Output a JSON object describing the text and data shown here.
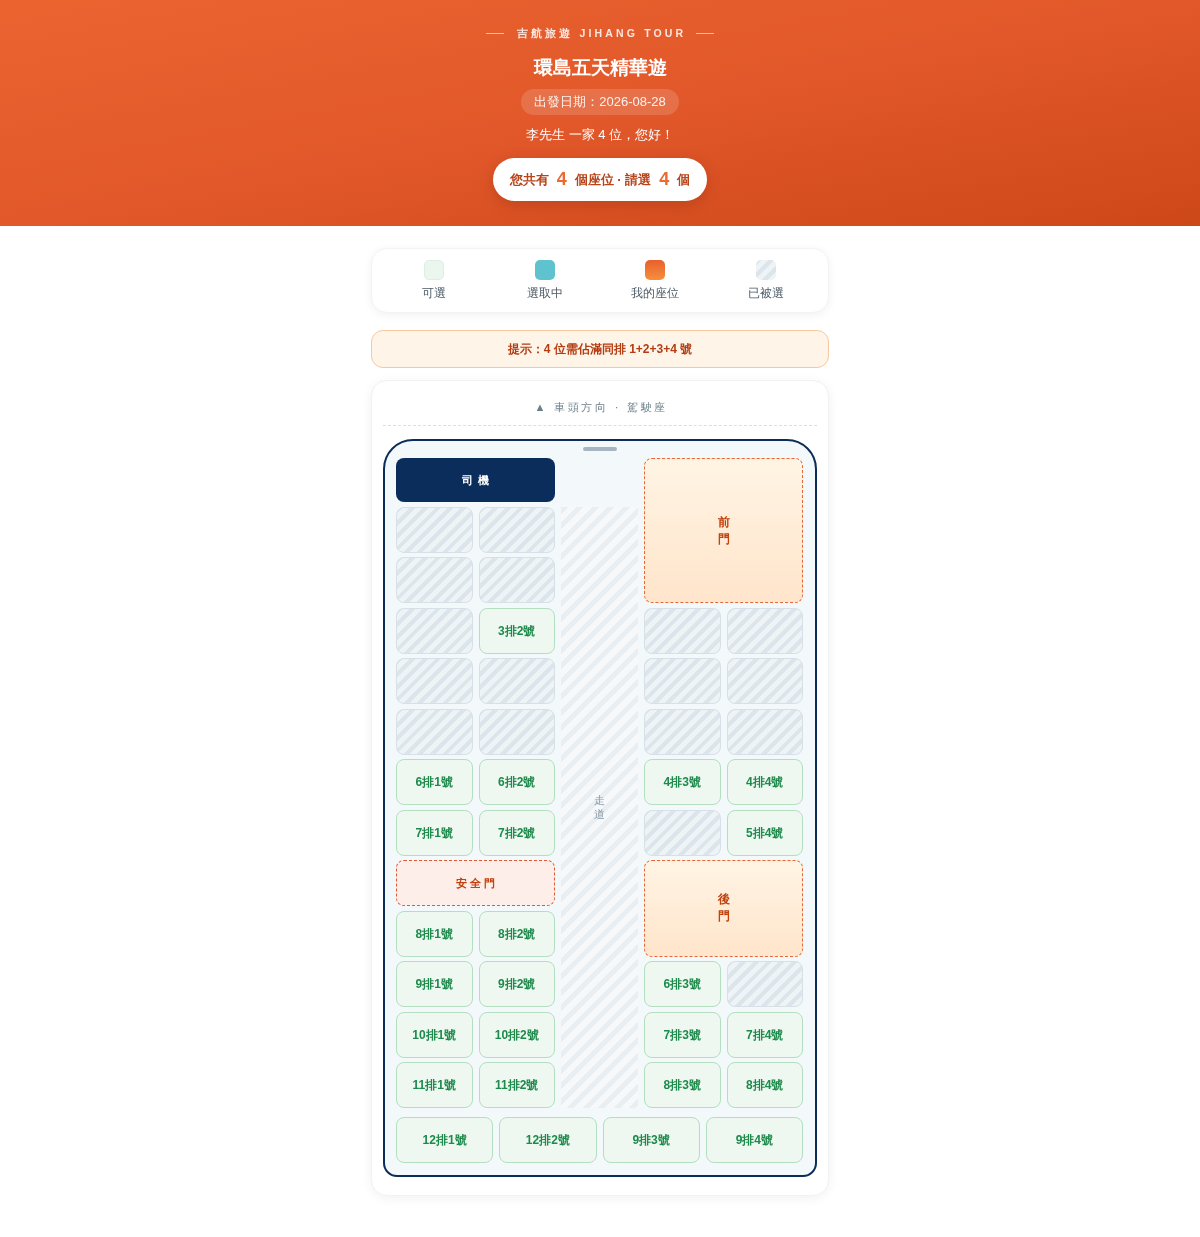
{
  "header": {
    "brand": "吉航旅遊 JIHANG TOUR",
    "title": "環島五天精華遊",
    "date": "出發日期：2026-08-28",
    "greeting": "李先生 一家 4 位，您好！",
    "summary": [
      {
        "kind": "text",
        "text": "您共有"
      },
      {
        "kind": "count",
        "text": "4"
      },
      {
        "kind": "text",
        "text": "個座位 · 請選"
      },
      {
        "kind": "count",
        "text": "4"
      },
      {
        "kind": "text",
        "text": "個"
      }
    ]
  },
  "legend": [
    {
      "kind": "available",
      "label": "可選"
    },
    {
      "kind": "selected",
      "label": "選取中"
    },
    {
      "kind": "mine",
      "label": "我的座位"
    },
    {
      "kind": "taken",
      "label": "已被選"
    }
  ],
  "hint": "提示：4 位需佔滿同排 1+2+3+4 號",
  "seat_map": {
    "direction": "▲ 車頭方向 · 駕駛座",
    "aisle": "走道",
    "left_side": [
      {
        "kind": "driver",
        "label": "司機"
      },
      {
        "kind": "pair",
        "seats": [
          {
            "taken": true,
            "selected": false
          },
          {
            "taken": true,
            "selected": false
          }
        ]
      },
      {
        "kind": "pair",
        "seats": [
          {
            "taken": true,
            "selected": false
          },
          {
            "taken": true,
            "selected": false
          }
        ]
      },
      {
        "kind": "pair",
        "seats": [
          {
            "taken": true,
            "selected": false
          },
          {
            "label": "3排2號",
            "taken": false,
            "selected": false
          }
        ]
      },
      {
        "kind": "pair",
        "seats": [
          {
            "taken": true,
            "selected": false
          },
          {
            "taken": true,
            "selected": false
          }
        ]
      },
      {
        "kind": "pair",
        "seats": [
          {
            "taken": true,
            "selected": false
          },
          {
            "taken": true,
            "selected": false
          }
        ]
      },
      {
        "kind": "pair",
        "seats": [
          {
            "label": "6排1號",
            "taken": false,
            "selected": false
          },
          {
            "label": "6排2號",
            "taken": false,
            "selected": false
          }
        ]
      },
      {
        "kind": "pair",
        "seats": [
          {
            "label": "7排1號",
            "taken": false,
            "selected": false
          },
          {
            "label": "7排2號",
            "taken": false,
            "selected": false
          }
        ]
      },
      {
        "kind": "emergency_door",
        "label": "安全門"
      },
      {
        "kind": "pair",
        "seats": [
          {
            "label": "8排1號",
            "taken": false,
            "selected": false
          },
          {
            "label": "8排2號",
            "taken": false,
            "selected": false
          }
        ]
      },
      {
        "kind": "pair",
        "seats": [
          {
            "label": "9排1號",
            "taken": false,
            "selected": false
          },
          {
            "label": "9排2號",
            "taken": false,
            "selected": false
          }
        ]
      },
      {
        "kind": "pair",
        "seats": [
          {
            "label": "10排1號",
            "taken": false,
            "selected": false
          },
          {
            "label": "10排2號",
            "taken": false,
            "selected": false
          }
        ]
      },
      {
        "kind": "pair",
        "seats": [
          {
            "label": "11排1號",
            "taken": false,
            "selected": false
          },
          {
            "label": "11排2號",
            "taken": false,
            "selected": false
          }
        ]
      }
    ],
    "right_side": [
      {
        "kind": "front_door",
        "label": "前門"
      },
      {
        "kind": "pair",
        "seats": [
          {
            "taken": true,
            "selected": false
          },
          {
            "taken": true,
            "selected": false
          }
        ]
      },
      {
        "kind": "pair",
        "seats": [
          {
            "taken": true,
            "selected": false
          },
          {
            "taken": true,
            "selected": false
          }
        ]
      },
      {
        "kind": "pair",
        "seats": [
          {
            "taken": true,
            "selected": false
          },
          {
            "taken": true,
            "selected": false
          }
        ]
      },
      {
        "kind": "pair",
        "seats": [
          {
            "label": "4排3號",
            "taken": false,
            "selected": false
          },
          {
            "label": "4排4號",
            "taken": false,
            "selected": false
          }
        ]
      },
      {
        "kind": "pair",
        "seats": [
          {
            "taken": true,
            "selected": false
          },
          {
            "label": "5排4號",
            "taken": false,
            "selected": false
          }
        ]
      },
      {
        "kind": "rear_door",
        "label": "後門"
      },
      {
        "kind": "pair",
        "seats": [
          {
            "label": "6排3號",
            "taken": false,
            "selected": false
          },
          {
            "taken": true,
            "selected": false
          }
        ]
      },
      {
        "kind": "pair",
        "seats": [
          {
            "label": "7排3號",
            "taken": false,
            "selected": false
          },
          {
            "label": "7排4號",
            "taken": false,
            "selected": false
          }
        ]
      },
      {
        "kind": "pair",
        "seats": [
          {
            "label": "8排3號",
            "taken": false,
            "selected": false
          },
          {
            "label": "8排4號",
            "taken": false,
            "selected": false
          }
        ]
      }
    ],
    "back_row": [
      {
        "label": "12排1號",
        "taken": false,
        "selected": false
      },
      {
        "label": "12排2號",
        "taken": false,
        "selected": false
      },
      {
        "label": "9排3號",
        "taken": false,
        "selected": false
      },
      {
        "label": "9排4號",
        "taken": false,
        "selected": false
      }
    ]
  }
}
